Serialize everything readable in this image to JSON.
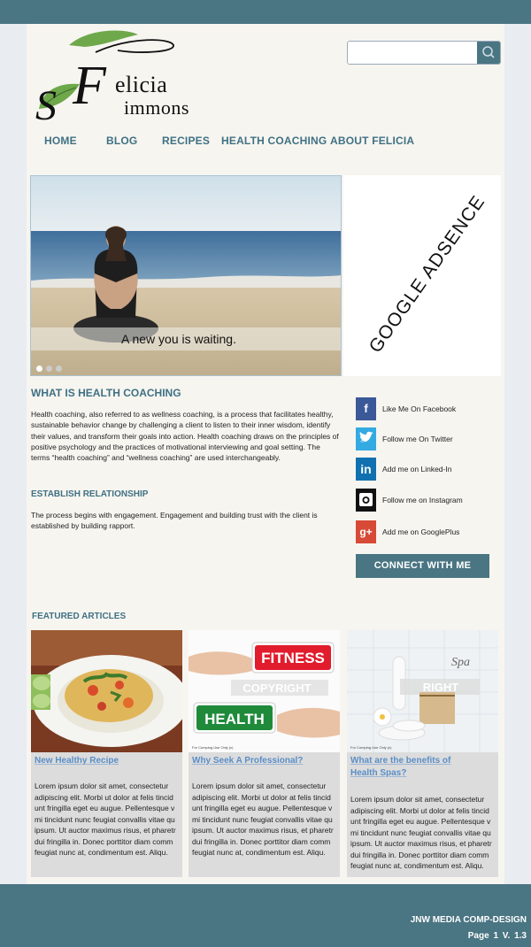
{
  "brand": {
    "first_name": "elicia",
    "last_name": "immons",
    "f_initial": "F",
    "s_initial": "S"
  },
  "search": {
    "placeholder": "",
    "value": ""
  },
  "nav": {
    "home": "HOME",
    "blog": "BLOG",
    "recipes": "RECIPES",
    "health_coaching": "HEALTH COACHING",
    "about": "ABOUT FELICIA"
  },
  "hero": {
    "caption": "A new you is waiting.",
    "slides": 3,
    "active_slide": 1
  },
  "ad": {
    "text": "GOOGLE ADSENCE"
  },
  "what": {
    "title": "WHAT IS HEALTH COACHING",
    "body": "Health coaching, also referred to as wellness coaching, is a process that facilitates healthy, sustainable behavior change by challenging a client to listen to their inner wisdom, identify their values, and transform their goals into action. Health coaching draws on the principles of positive psychology and the practices of motivational interviewing and goal setting. The terms “health coaching” and “wellness coaching” are used interchangeably."
  },
  "establish": {
    "title": "ESTABLISH RELATIONSHIP",
    "body": "The process begins with engagement. Engagement and building trust with the client is established by building rapport."
  },
  "social": {
    "facebook": "Like Me On Facebook",
    "twitter": "Follow me On Twitter",
    "linkedin": "Add me on Linked-In",
    "instagram": "Follow me on Instagram",
    "googleplus": "Add me on GooglePlus"
  },
  "connect": "CONNECT WITH ME",
  "featured": {
    "title": "FEATURED ARTICLES",
    "articles": [
      {
        "title_1": "New Healthy Recipe",
        "title_2": "",
        "body": "Lorem ipsum dolor sit amet, consectetur adipiscing elit. Morbi ut dolor at felis tincid unt fringilla eget eu augue. Pellentesque v mi tincidunt nunc feugiat convallis vitae qu ipsum. Ut auctor maximus risus, et pharetr dui fringilla in. Donec porttitor diam comm feugiat nunc  at, condimentum est. Aliqu."
      },
      {
        "title_1": "Why Seek A Professional?",
        "title_2": "",
        "sign_1": "FITNESS",
        "sign_2": "HEALTH",
        "watermark": "COPYRIGHT",
        "small": "For Comping Use Only (c)",
        "body": "Lorem ipsum dolor sit amet, consectetur adipiscing elit. Morbi ut dolor at felis tincid unt fringilla eget eu augue. Pellentesque v mi tincidunt nunc feugiat convallis vitae qu ipsum. Ut auctor maximus risus, et pharetr dui fringilla in. Donec porttitor diam comm feugiat nunc  at, condimentum est. Aliqu."
      },
      {
        "title_1": "What are the benefits of",
        "title_2": "Health Spas?",
        "spa": "Spa",
        "watermark": "RIGHT",
        "small": "For Comping Use Only (c)",
        "body": "Lorem ipsum dolor sit amet, consectetur adipiscing elit. Morbi ut dolor at felis tincid unt fringilla eget eu augue. Pellentesque v mi tincidunt nunc feugiat convallis vitae qu ipsum. Ut auctor maximus risus, et pharetr dui fringilla in. Donec porttitor diam comm feugiat nunc  at, condimentum est. Aliqu."
      }
    ]
  },
  "footer": {
    "line1": "JNW MEDIA COMP-DESIGN",
    "line2": "Page 1  V. 1.3"
  },
  "colors": {
    "teal": "#4a7582",
    "nav_text": "#3f7184",
    "link_blue": "#5a8ec7"
  }
}
